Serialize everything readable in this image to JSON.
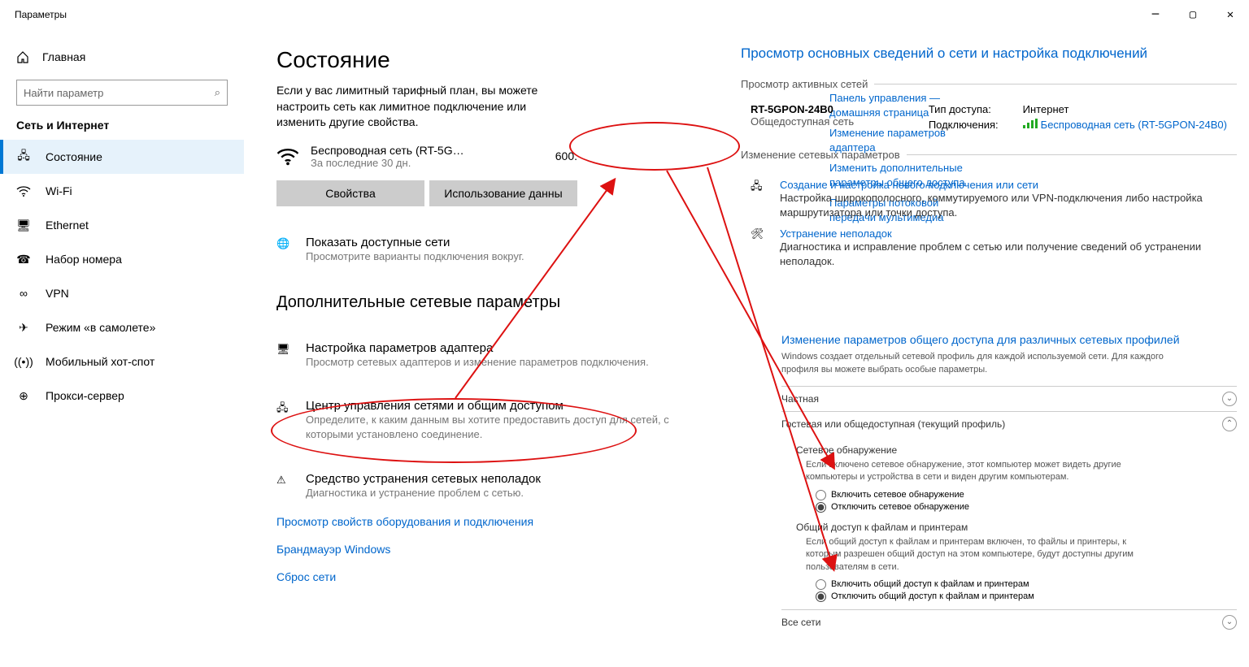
{
  "window_title": "Параметры",
  "home_label": "Главная",
  "search_placeholder": "Найти параметр",
  "sidebar_title": "Сеть и Интернет",
  "nav": [
    {
      "label": "Состояние"
    },
    {
      "label": "Wi-Fi"
    },
    {
      "label": "Ethernet"
    },
    {
      "label": "Набор номера"
    },
    {
      "label": "VPN"
    },
    {
      "label": "Режим «в самолете»"
    },
    {
      "label": "Мобильный хот-спот"
    },
    {
      "label": "Прокси-сервер"
    }
  ],
  "page_heading": "Состояние",
  "intro": "Если у вас лимитный тарифный план, вы можете настроить сеть как лимитное подключение или изменить другие свойства.",
  "wifi_name": "Беспроводная сеть (RT-5G…",
  "wifi_period": "За последние 30 дн.",
  "wifi_usage": "600.",
  "btn_props": "Свойства",
  "btn_usage": "Использование данны",
  "show_nets_title": "Показать доступные сети",
  "show_nets_desc": "Просмотрите варианты подключения вокруг.",
  "adv_heading": "Дополнительные сетевые параметры",
  "adapter_title": "Настройка параметров адаптера",
  "adapter_desc": "Просмотр сетевых адаптеров и изменение параметров подключения.",
  "center_title": "Центр управления сетями и общим доступом",
  "center_desc": "Определите, к каким данным вы хотите предоставить доступ для сетей, с которыми установлено соединение.",
  "trouble_title": "Средство устранения сетевых неполадок",
  "trouble_desc": "Диагностика и устранение проблем с сетью.",
  "link_hw": "Просмотр свойств оборудования и подключения",
  "link_fw": "Брандмауэр Windows",
  "link_reset": "Сброс сети",
  "cp_links": [
    "Панель управления — домашняя страница",
    "Изменение параметров адаптера",
    "Изменить дополнительные параметры общего доступа",
    "Параметры потоковой передачи мультимедиа"
  ],
  "nc": {
    "title": "Просмотр основных сведений о сети и настройка подключений",
    "active_legend": "Просмотр активных сетей",
    "net_name": "RT-5GPON-24B0",
    "net_type": "Общедоступная сеть",
    "access_label": "Тип доступа:",
    "access_value": "Интернет",
    "conn_label": "Подключения:",
    "conn_value": "Беспроводная сеть (RT-5GPON-24B0)",
    "change_legend": "Изменение сетевых параметров",
    "row1_link": "Создание и настройка нового подключения или сети",
    "row1_desc": "Настройка широкополосного, коммутируемого или VPN-подключения либо настройка маршрутизатора или точки доступа.",
    "row2_link": "Устранение неполадок",
    "row2_desc": "Диагностика и исправление проблем с сетью или получение сведений об устранении неполадок."
  },
  "sharing": {
    "title": "Изменение параметров общего доступа для различных сетевых профилей",
    "desc": "Windows создает отдельный сетевой профиль для каждой используемой сети. Для каждого профиля вы можете выбрать особые параметры.",
    "sec_private": "Частная",
    "sec_guest": "Гостевая или общедоступная (текущий профиль)",
    "sec_all": "Все сети",
    "disc_head": "Сетевое обнаружение",
    "disc_text": "Если включено сетевое обнаружение, этот компьютер может видеть другие компьютеры и устройства в сети и виден другим компьютерам.",
    "disc_on": "Включить сетевое обнаружение",
    "disc_off": "Отключить сетевое обнаружение",
    "share_head": "Общий доступ к файлам и принтерам",
    "share_text": "Если общий доступ к файлам и принтерам включен, то файлы и принтеры, к которым разрешен общий доступ на этом компьютере, будут доступны другим пользователям в сети.",
    "share_on": "Включить общий доступ к файлам и принтерам",
    "share_off": "Отключить общий доступ к файлам и принтерам"
  }
}
